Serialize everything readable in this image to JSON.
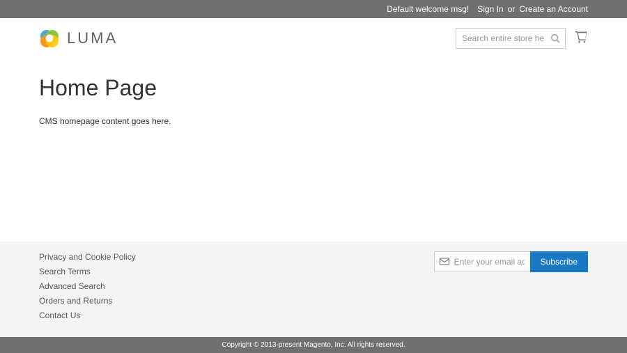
{
  "panel": {
    "welcome": "Default welcome msg!",
    "signin": "Sign In",
    "or": "or",
    "create": "Create an Account"
  },
  "header": {
    "logo_text": "LUMA",
    "search_placeholder": "Search entire store here..."
  },
  "main": {
    "title": "Home Page",
    "cms_content": "CMS homepage content goes here."
  },
  "footer": {
    "links": [
      "Privacy and Cookie Policy",
      "Search Terms",
      "Advanced Search",
      "Orders and Returns",
      "Contact Us"
    ],
    "newsletter_placeholder": "Enter your email address",
    "subscribe": "Subscribe"
  },
  "copyright": "Copyright © 2013-present Magento, Inc. All rights reserved."
}
